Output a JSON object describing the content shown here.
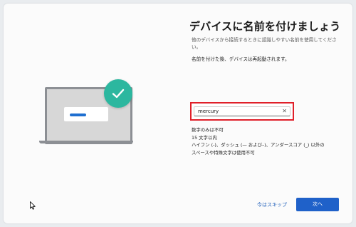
{
  "header": {
    "title": "デバイスに名前を付けましょう"
  },
  "content": {
    "description": "他のデバイスから接続するときに認識しやすい名前を使用してください。",
    "restart_note": "名前を付けた後、デバイスは再起動されます。"
  },
  "name_field": {
    "value": "mercury",
    "clear_icon": "✕"
  },
  "rules": {
    "items": [
      "数字のみは不可",
      "15 文字以内",
      "ハイフン (-)、ダッシュ (— および–)、アンダースコア (_) 以外の",
      "スペースや特殊文字は使用不可"
    ]
  },
  "footer": {
    "skip_label": "今はスキップ",
    "next_label": "次へ"
  },
  "icons": {
    "check": "check-icon",
    "cursor": "mouse-pointer-icon",
    "clear": "close-icon"
  },
  "colors": {
    "accent": "#1f61c9",
    "check_badge": "#2cb79f",
    "highlight_border": "#e0202a",
    "link": "#1a5bb8"
  }
}
